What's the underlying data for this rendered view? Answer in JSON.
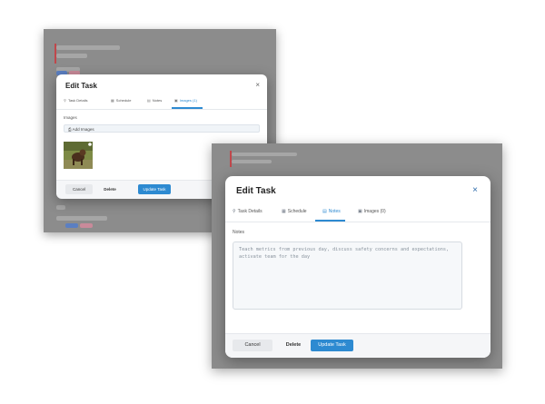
{
  "back_window": {
    "title": "Edit Task",
    "close_glyph": "×",
    "tabs": [
      {
        "icon": "pin-icon",
        "glyph": "⚲",
        "label": "Task Details",
        "active": false
      },
      {
        "icon": "calendar-icon",
        "glyph": "▦",
        "label": "Schedule",
        "active": false
      },
      {
        "icon": "notes-icon",
        "glyph": "▤",
        "label": "Notes",
        "active": false
      },
      {
        "icon": "image-icon",
        "glyph": "▣",
        "label": "Images (1)",
        "active": true
      }
    ],
    "section_label": "Images",
    "add_images_label": "Add Images",
    "add_images_glyph": "⎙",
    "image_count": 1,
    "footer": {
      "cancel": "Cancel",
      "delete": "Delete",
      "update": "Update Task"
    }
  },
  "front_window": {
    "title": "Edit Task",
    "close_glyph": "×",
    "tabs": [
      {
        "icon": "pin-icon",
        "glyph": "⚲",
        "label": "Task Details",
        "active": false
      },
      {
        "icon": "calendar-icon",
        "glyph": "▦",
        "label": "Schedule",
        "active": false
      },
      {
        "icon": "notes-icon",
        "glyph": "▤",
        "label": "Notes",
        "active": true
      },
      {
        "icon": "image-icon",
        "glyph": "▣",
        "label": "Images (0)",
        "active": false
      }
    ],
    "notes_label": "Notes",
    "notes_value": "Teach metrics from previous day, discuss safety concerns and expectations, activate team for the day",
    "footer": {
      "cancel": "Cancel",
      "delete": "Delete",
      "update": "Update Task"
    }
  },
  "colors": {
    "accent": "#2d8ad1",
    "overlay": "#8c8c8c",
    "flag_red": "#c0474b",
    "tag_blue": "#5b7fc2",
    "tag_pink": "#c98a9a"
  }
}
